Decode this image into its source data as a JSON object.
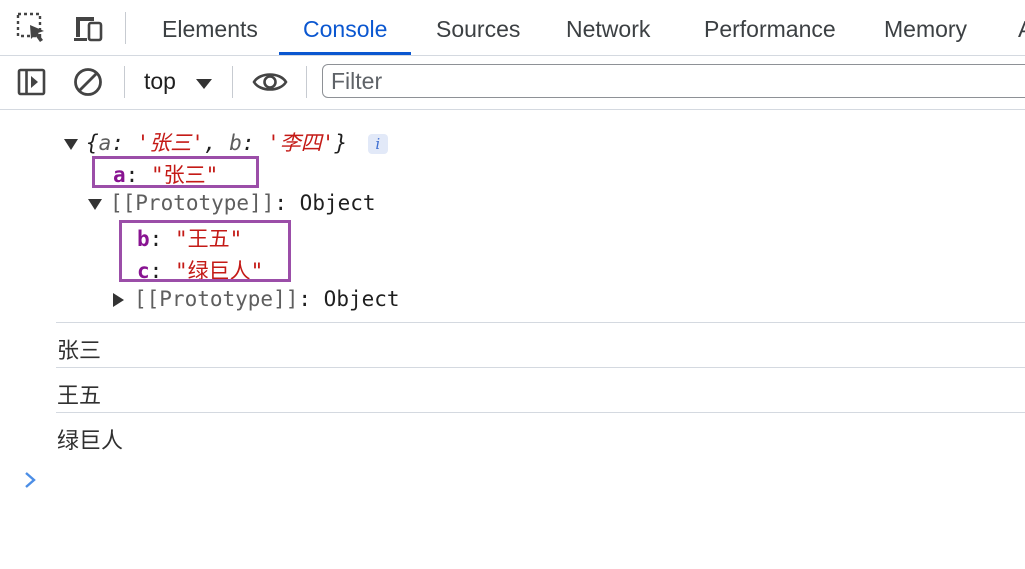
{
  "tabs": [
    {
      "label": "Elements"
    },
    {
      "label": "Console",
      "active": true
    },
    {
      "label": "Sources"
    },
    {
      "label": "Network"
    },
    {
      "label": "Performance"
    },
    {
      "label": "Memory"
    }
  ],
  "tab_overflow": "A",
  "toolbar": {
    "context": "top",
    "filter_placeholder": "Filter"
  },
  "console": {
    "object_preview": {
      "open": "{",
      "k1": "a",
      "v1": "'张三'",
      "comma": ", ",
      "k2": "b",
      "v2": "'李四'",
      "close": "}",
      "info": "i"
    },
    "own_prop": {
      "key": "a",
      "value": "\"张三\""
    },
    "prototype_label": "[[Prototype]]",
    "prototype_type": "Object",
    "proto_props": [
      {
        "key": "b",
        "value": "\"王五\""
      },
      {
        "key": "c",
        "value": "\"绿巨人\""
      }
    ],
    "nested_prototype_label": "[[Prototype]]",
    "nested_prototype_type": "Object",
    "logs": [
      "张三",
      "王五",
      "绿巨人"
    ]
  },
  "colors": {
    "accent": "#0b57d0",
    "highlight_box": "#9b4ea8",
    "key": "#881391",
    "string": "#c41a16",
    "prompt": "#4c8ee6"
  },
  "icons": [
    "inspect-element-icon",
    "device-toolbar-icon",
    "sidebar-toggle-icon",
    "clear-console-icon",
    "dropdown-caret-icon",
    "live-expression-eye-icon",
    "info-icon",
    "prompt-chevron-icon"
  ]
}
